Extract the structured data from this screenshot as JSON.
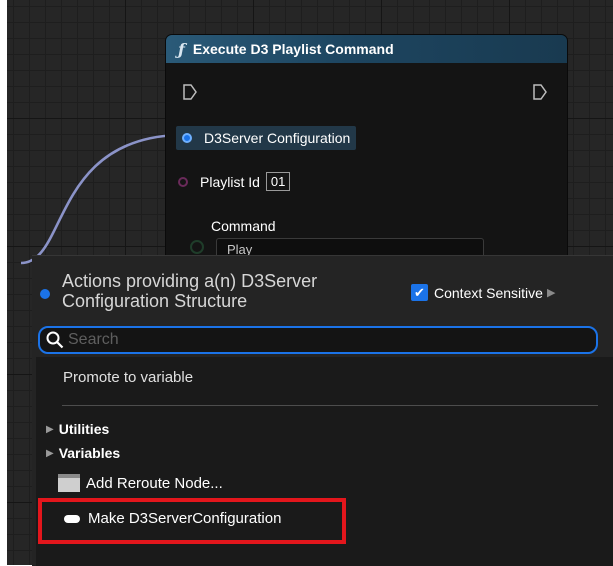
{
  "node": {
    "title": "Execute D3 Playlist Command",
    "pins": {
      "config_label": "D3Server Configuration",
      "playlist_label": "Playlist Id",
      "playlist_value": "01",
      "command_label": "Command",
      "command_value": "Play"
    }
  },
  "menu": {
    "title": "Actions providing a(n) D3Server Configuration Structure",
    "context_sensitive_label": "Context Sensitive",
    "context_sensitive_checked": true,
    "search_placeholder": "Search",
    "promote_label": "Promote to variable",
    "categories": [
      "Utilities",
      "Variables"
    ],
    "items": [
      "Add Reroute Node...",
      "Make D3ServerConfiguration"
    ]
  },
  "colors": {
    "accent": "#1b73e8",
    "highlight": "#e3161c",
    "wire": "#8b93c8"
  }
}
